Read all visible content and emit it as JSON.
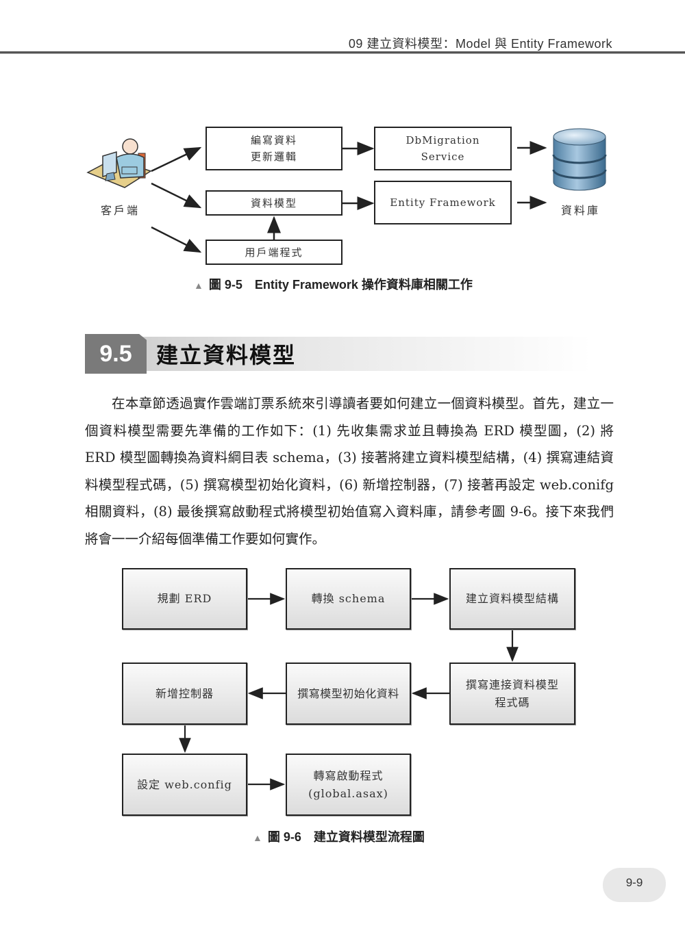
{
  "header": {
    "running_head": "09  建立資料模型：Model 與 Entity Framework"
  },
  "figure_9_5": {
    "client_label": "客戶端",
    "client_icon": "user-at-computer-icon",
    "database_label": "資料庫",
    "database_icon": "database-cylinder-icon",
    "boxes": {
      "update_logic_line1": "編寫資料",
      "update_logic_line2": "更新邏輯",
      "data_model": "資料模型",
      "client_program": "用戶端程式",
      "dbmigration_line1": "DbMigration",
      "dbmigration_line2": "Service",
      "entity_framework": "Entity Framework"
    },
    "caption": {
      "marker": "▲",
      "number": "圖 9-5",
      "text": "Entity Framework 操作資料庫相關工作"
    }
  },
  "section": {
    "number": "9.5",
    "title": "建立資料模型"
  },
  "body": {
    "paragraph": "在本章節透過實作雲端訂票系統來引導讀者要如何建立一個資料模型。首先，建立一個資料模型需要先準備的工作如下：(1) 先收集需求並且轉換為 ERD 模型圖，(2) 將 ERD 模型圖轉換為資料綱目表 schema，(3) 接著將建立資料模型結構，(4) 撰寫連結資料模型程式碼，(5) 撰寫模型初始化資料，(6) 新增控制器，(7) 接著再設定 web.conifg 相關資料，(8) 最後撰寫啟動程式將模型初始值寫入資料庫，請參考圖 9-6。接下來我們將會一一介紹每個準備工作要如何實作。"
  },
  "figure_9_6": {
    "steps": [
      {
        "line1": "規劃 ERD",
        "line2": ""
      },
      {
        "line1": "轉換 schema",
        "line2": ""
      },
      {
        "line1": "建立資料模型結構",
        "line2": ""
      },
      {
        "line1": "撰寫連接資料模型",
        "line2": "程式碼"
      },
      {
        "line1": "撰寫模型初始化資料",
        "line2": ""
      },
      {
        "line1": "新增控制器",
        "line2": ""
      },
      {
        "line1": "設定 web.config",
        "line2": ""
      },
      {
        "line1": "轉寫啟動程式",
        "line2": "(global.asax)"
      }
    ],
    "caption": {
      "marker": "▲",
      "number": "圖 9-6",
      "text": "建立資料模型流程圖"
    }
  },
  "footer": {
    "page_number": "9-9"
  }
}
